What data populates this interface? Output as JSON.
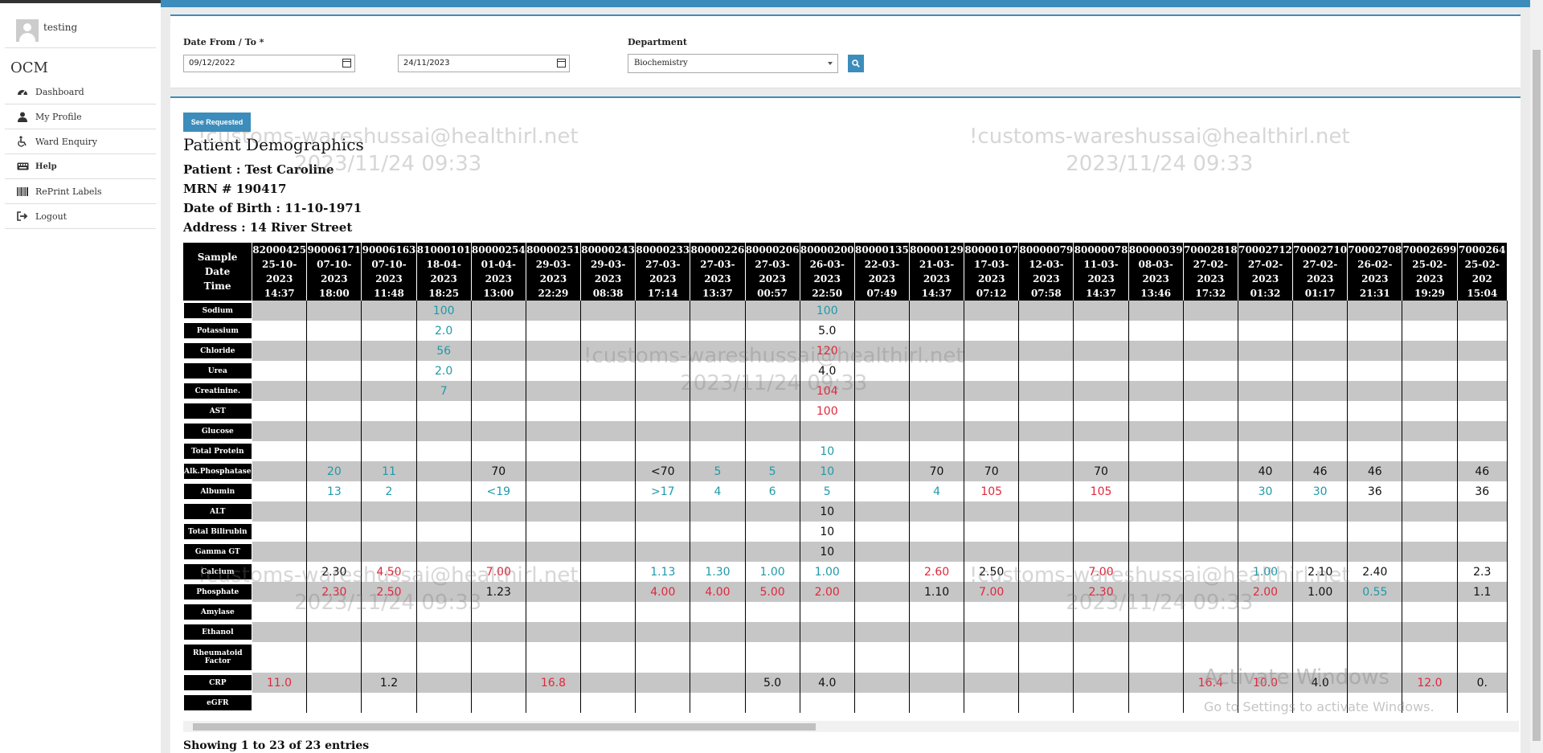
{
  "sidebar": {
    "username": "testing",
    "brand": "OCM",
    "items": [
      {
        "label": "Dashboard",
        "icon": "dashboard-icon"
      },
      {
        "label": "My Profile",
        "icon": "user-icon"
      },
      {
        "label": "Ward Enquiry",
        "icon": "wheelchair-icon"
      },
      {
        "label": "Help",
        "icon": "keyboard-icon"
      },
      {
        "label": "RePrint Labels",
        "icon": "barcode-icon"
      },
      {
        "label": "Logout",
        "icon": "sign-out-icon"
      }
    ]
  },
  "filter": {
    "date_label": "Date From / To *",
    "date_from": "09/12/2022",
    "date_to": "24/11/2023",
    "department_label": "Department",
    "department_value": "Biochemistry",
    "search_icon": "search-icon"
  },
  "results": {
    "see_requested_label": "See Requested",
    "title": "Patient Demographics",
    "patient": "Patient : Test Caroline",
    "mrn": "MRN # 190417",
    "dob": "Date of Birth : 11-10-1971",
    "address": "Address : 14 River Street",
    "footer": "Showing 1 to 23 of 23 entries"
  },
  "table": {
    "header_label": [
      "Sample",
      "Date",
      "Time"
    ],
    "columns": [
      {
        "sample": "82000425",
        "date": "25-10-2023",
        "time": "14:37"
      },
      {
        "sample": "90006171",
        "date": "07-10-2023",
        "time": "18:00"
      },
      {
        "sample": "90006163",
        "date": "07-10-2023",
        "time": "11:48"
      },
      {
        "sample": "81000101",
        "date": "18-04-2023",
        "time": "18:25"
      },
      {
        "sample": "80000254",
        "date": "01-04-2023",
        "time": "13:00"
      },
      {
        "sample": "80000251",
        "date": "29-03-2023",
        "time": "22:29"
      },
      {
        "sample": "80000243",
        "date": "29-03-2023",
        "time": "08:38"
      },
      {
        "sample": "80000233",
        "date": "27-03-2023",
        "time": "17:14"
      },
      {
        "sample": "80000226",
        "date": "27-03-2023",
        "time": "13:37"
      },
      {
        "sample": "80000206",
        "date": "27-03-2023",
        "time": "00:57"
      },
      {
        "sample": "80000200",
        "date": "26-03-2023",
        "time": "22:50"
      },
      {
        "sample": "80000135",
        "date": "22-03-2023",
        "time": "07:49"
      },
      {
        "sample": "80000129",
        "date": "21-03-2023",
        "time": "14:37"
      },
      {
        "sample": "80000107",
        "date": "17-03-2023",
        "time": "07:12"
      },
      {
        "sample": "80000079",
        "date": "12-03-2023",
        "time": "07:58"
      },
      {
        "sample": "80000078",
        "date": "11-03-2023",
        "time": "14:37"
      },
      {
        "sample": "80000039",
        "date": "08-03-2023",
        "time": "13:46"
      },
      {
        "sample": "70002818",
        "date": "27-02-2023",
        "time": "17:32"
      },
      {
        "sample": "70002712",
        "date": "27-02-2023",
        "time": "01:32"
      },
      {
        "sample": "70002710",
        "date": "27-02-2023",
        "time": "01:17"
      },
      {
        "sample": "70002708",
        "date": "26-02-2023",
        "time": "21:31"
      },
      {
        "sample": "70002699",
        "date": "25-02-2023",
        "time": "19:29"
      },
      {
        "sample": "7000264",
        "date": "25-02-202",
        "time": "15:04"
      }
    ],
    "rows": [
      {
        "label": "Sodium",
        "cells": {
          "3": [
            "100",
            "teal"
          ],
          "10": [
            "100",
            "teal"
          ]
        }
      },
      {
        "label": "Potassium",
        "cells": {
          "3": [
            "2.0",
            "teal"
          ],
          "10": [
            "5.0",
            "black"
          ]
        }
      },
      {
        "label": "Chloride",
        "cells": {
          "3": [
            "56",
            "teal"
          ],
          "10": [
            "120",
            "red"
          ]
        }
      },
      {
        "label": "Urea",
        "cells": {
          "3": [
            "2.0",
            "teal"
          ],
          "10": [
            "4.0",
            "black"
          ]
        }
      },
      {
        "label": "Creatinine.",
        "cells": {
          "3": [
            "7",
            "teal"
          ],
          "10": [
            "104",
            "red"
          ]
        }
      },
      {
        "label": "AST",
        "cells": {
          "10": [
            "100",
            "red"
          ]
        }
      },
      {
        "label": "Glucose",
        "cells": {}
      },
      {
        "label": "Total Protein",
        "cells": {
          "10": [
            "10",
            "teal"
          ]
        }
      },
      {
        "label": "Alk.Phosphatase",
        "cells": {
          "1": [
            "20",
            "teal"
          ],
          "2": [
            "11",
            "teal"
          ],
          "4": [
            "70",
            "black"
          ],
          "7": [
            "<70",
            "black"
          ],
          "8": [
            "5",
            "teal"
          ],
          "9": [
            "5",
            "teal"
          ],
          "10": [
            "10",
            "teal"
          ],
          "12": [
            "70",
            "black"
          ],
          "13": [
            "70",
            "black"
          ],
          "15": [
            "70",
            "black"
          ],
          "18": [
            "40",
            "black"
          ],
          "19": [
            "46",
            "black"
          ],
          "20": [
            "46",
            "black"
          ],
          "22": [
            "46",
            "black"
          ]
        }
      },
      {
        "label": "Albumin",
        "cells": {
          "1": [
            "13",
            "teal"
          ],
          "2": [
            "2",
            "teal"
          ],
          "4": [
            "<19",
            "teal"
          ],
          "7": [
            ">17",
            "teal"
          ],
          "8": [
            "4",
            "teal"
          ],
          "9": [
            "6",
            "teal"
          ],
          "10": [
            "5",
            "teal"
          ],
          "12": [
            "4",
            "teal"
          ],
          "13": [
            "105",
            "red"
          ],
          "15": [
            "105",
            "red"
          ],
          "18": [
            "30",
            "teal"
          ],
          "19": [
            "30",
            "teal"
          ],
          "20": [
            "36",
            "black"
          ],
          "22": [
            "36",
            "black"
          ]
        }
      },
      {
        "label": "ALT",
        "cells": {
          "10": [
            "10",
            "black"
          ]
        }
      },
      {
        "label": "Total Bilirubin",
        "cells": {
          "10": [
            "10",
            "black"
          ]
        }
      },
      {
        "label": "Gamma GT",
        "cells": {
          "10": [
            "10",
            "black"
          ]
        }
      },
      {
        "label": "Calcium",
        "cells": {
          "1": [
            "2.30",
            "black"
          ],
          "2": [
            "4.50",
            "red"
          ],
          "4": [
            "7.00",
            "red"
          ],
          "7": [
            "1.13",
            "teal"
          ],
          "8": [
            "1.30",
            "teal"
          ],
          "9": [
            "1.00",
            "teal"
          ],
          "10": [
            "1.00",
            "teal"
          ],
          "12": [
            "2.60",
            "red"
          ],
          "13": [
            "2.50",
            "black"
          ],
          "15": [
            "7.00",
            "red"
          ],
          "18": [
            "1.00",
            "teal"
          ],
          "19": [
            "2.10",
            "black"
          ],
          "20": [
            "2.40",
            "black"
          ],
          "22": [
            "2.3",
            "black"
          ]
        }
      },
      {
        "label": "Phosphate",
        "cells": {
          "1": [
            "2.30",
            "red"
          ],
          "2": [
            "2.50",
            "red"
          ],
          "4": [
            "1.23",
            "black"
          ],
          "7": [
            "4.00",
            "red"
          ],
          "8": [
            "4.00",
            "red"
          ],
          "9": [
            "5.00",
            "red"
          ],
          "10": [
            "2.00",
            "red"
          ],
          "12": [
            "1.10",
            "black"
          ],
          "13": [
            "7.00",
            "red"
          ],
          "15": [
            "2.30",
            "red"
          ],
          "18": [
            "2.00",
            "red"
          ],
          "19": [
            "1.00",
            "black"
          ],
          "20": [
            "0.55",
            "teal"
          ],
          "22": [
            "1.1",
            "black"
          ]
        }
      },
      {
        "label": "Amylase",
        "cells": {}
      },
      {
        "label": "Ethanol",
        "cells": {}
      },
      {
        "label": "Rheumatoid Factor",
        "cells": {},
        "tall": true
      },
      {
        "label": "CRP",
        "cells": {
          "0": [
            "11.0",
            "red"
          ],
          "2": [
            "1.2",
            "black"
          ],
          "5": [
            "16.8",
            "red"
          ],
          "9": [
            "5.0",
            "black"
          ],
          "10": [
            "4.0",
            "black"
          ],
          "17": [
            "16.4",
            "red"
          ],
          "18": [
            "10.0",
            "red"
          ],
          "19": [
            "4.0",
            "black"
          ],
          "21": [
            "12.0",
            "red"
          ],
          "22": [
            "0.",
            "black"
          ]
        }
      },
      {
        "label": "eGFR",
        "cells": {}
      }
    ]
  },
  "watermark": {
    "line1": "!customs-wareshussai@healthirl.net",
    "line2": "2023/11/24 09:33"
  },
  "activate_windows": {
    "title": "Activate Windows",
    "subtitle": "Go to Settings to activate Windows."
  },
  "colors": {
    "accent": "#3c8dbc",
    "teal": "#1f9aa8",
    "red": "#e0283c",
    "grey_row": "#c6c6c6"
  }
}
